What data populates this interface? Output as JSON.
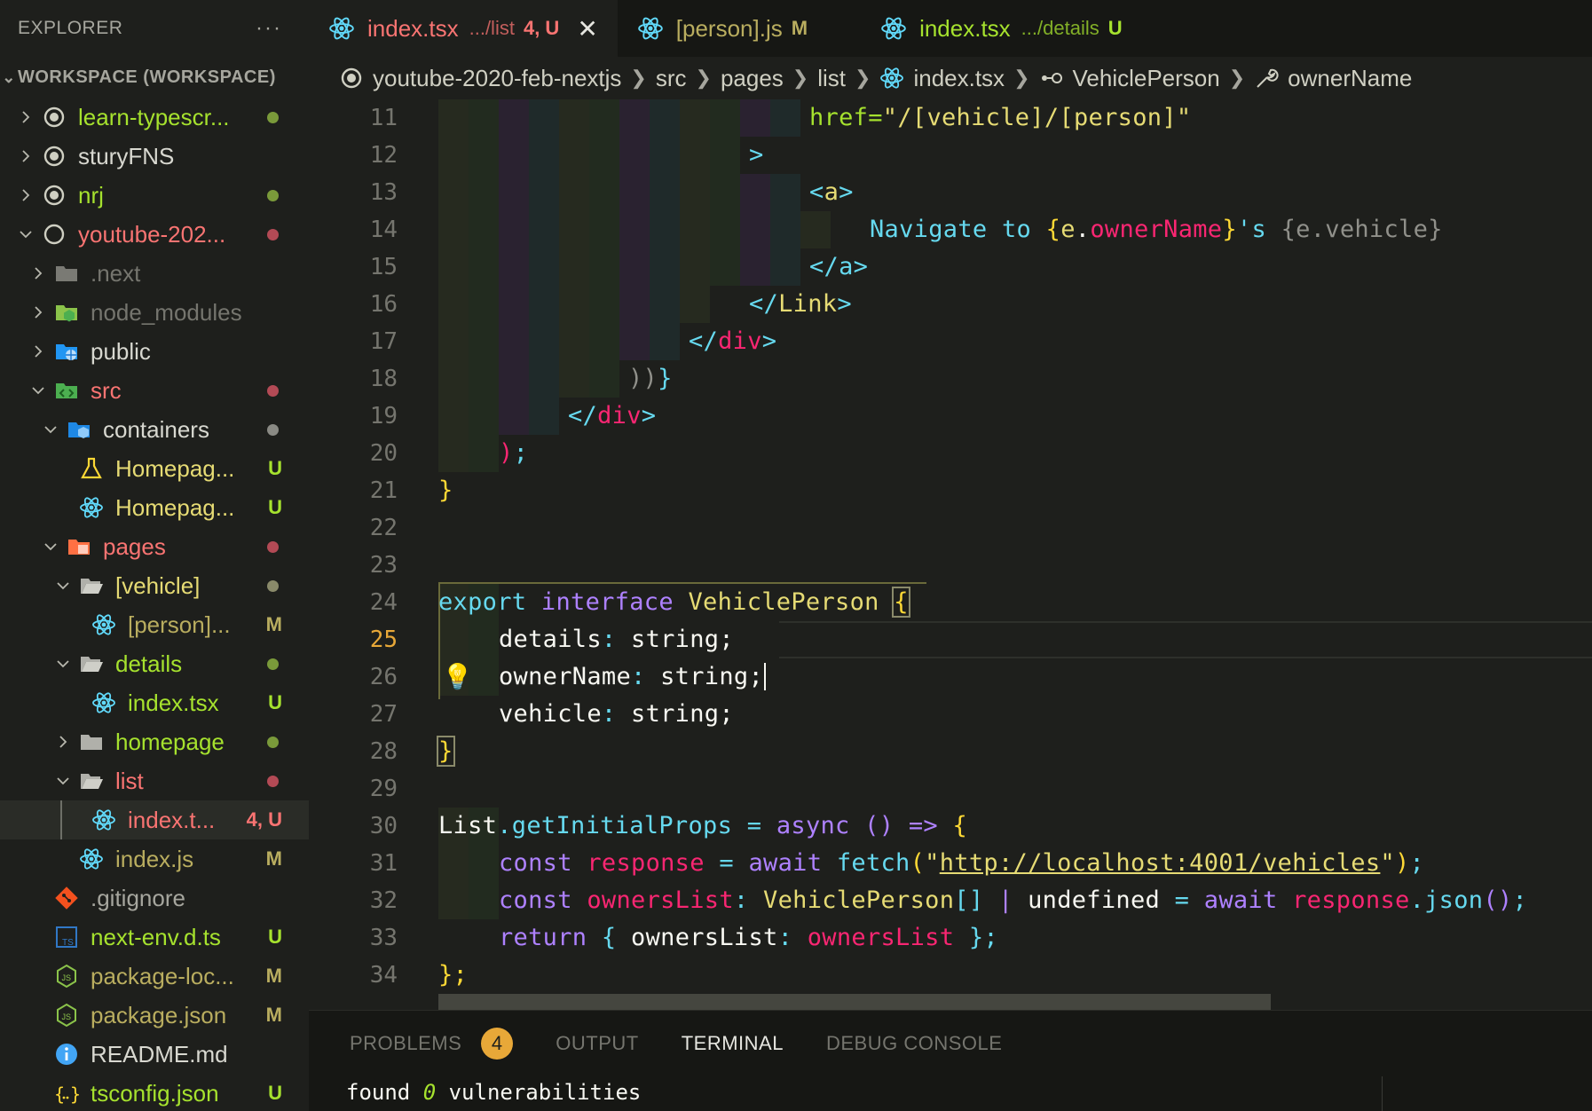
{
  "sidebar": {
    "title": "EXPLORER",
    "more": "···",
    "workspace": "WORKSPACE (WORKSPACE)",
    "items": [
      {
        "label": "learn-typescr...",
        "deco": ""
      },
      {
        "label": "sturyFNS",
        "deco": ""
      },
      {
        "label": "nrj",
        "deco": ""
      },
      {
        "label": "youtube-202...",
        "deco": ""
      },
      {
        "label": ".next",
        "deco": ""
      },
      {
        "label": "node_modules",
        "deco": ""
      },
      {
        "label": "public",
        "deco": ""
      },
      {
        "label": "src",
        "deco": ""
      },
      {
        "label": "containers",
        "deco": ""
      },
      {
        "label": "Homepag...",
        "deco": "U"
      },
      {
        "label": "Homepag...",
        "deco": "U"
      },
      {
        "label": "pages",
        "deco": ""
      },
      {
        "label": "[vehicle]",
        "deco": ""
      },
      {
        "label": "[person]...",
        "deco": "M"
      },
      {
        "label": "details",
        "deco": ""
      },
      {
        "label": "index.tsx",
        "deco": "U"
      },
      {
        "label": "homepage",
        "deco": ""
      },
      {
        "label": "list",
        "deco": ""
      },
      {
        "label": "index.t...",
        "deco": "4, U"
      },
      {
        "label": "index.js",
        "deco": "M"
      },
      {
        "label": ".gitignore",
        "deco": ""
      },
      {
        "label": "next-env.d.ts",
        "deco": "U"
      },
      {
        "label": "package-loc...",
        "deco": "M"
      },
      {
        "label": "package.json",
        "deco": "M"
      },
      {
        "label": "README.md",
        "deco": ""
      },
      {
        "label": "tsconfig.json",
        "deco": "U"
      }
    ]
  },
  "tabs": [
    {
      "label": "index.tsx",
      "desc": ".../list",
      "deco": "4, U",
      "close": "✕"
    },
    {
      "label": "[person].js",
      "desc": "",
      "deco": "M"
    },
    {
      "label": "index.tsx",
      "desc": ".../details",
      "deco": "U"
    }
  ],
  "breadcrumbs": [
    "youtube-2020-feb-nextjs",
    "src",
    "pages",
    "list",
    "index.tsx",
    "VehiclePerson",
    "ownerName"
  ],
  "editor": {
    "line_numbers": [
      "11",
      "12",
      "13",
      "14",
      "15",
      "16",
      "17",
      "18",
      "19",
      "20",
      "21",
      "22",
      "23",
      "24",
      "25",
      "26",
      "27",
      "28",
      "29",
      "30",
      "31",
      "32",
      "33",
      "34"
    ],
    "code": {
      "l11_attr": "href=",
      "l11_val": "\"/[vehicle]/[person]\"",
      "l12": ">",
      "l13_open": "<",
      "l13_tag": "a",
      "l13_close": ">",
      "l14_text": "Navigate to ",
      "l14_ob": "{",
      "l14_e": "e",
      "l14_dot": ".",
      "l14_prop": "ownerName",
      "l14_cb": "}",
      "l14_s": "'s ",
      "l14_expr2": "{e.vehicle}",
      "l15": "</a>",
      "l16_a": "</",
      "l16_tag": "Link",
      "l16_b": ">",
      "l17_a": "</",
      "l17_tag": "div",
      "l17_b": ">",
      "l18_a": "))",
      "l18_b": "}",
      "l19_a": "</",
      "l19_tag": "div",
      "l19_b": ">",
      "l20_a": ")",
      "l20_b": ";",
      "l21": "}",
      "l23_export": "export",
      "l23_interface": "interface",
      "l23_name": "VehiclePerson",
      "l23_brace": "{",
      "l24_prop": "details",
      "l24_type": "string;",
      "l25_prop": "ownerName",
      "l25_type": "string;",
      "l26_prop": "vehicle",
      "l26_type": "string;",
      "l27": "}",
      "l29_obj": "List",
      "l29_fn": "getInitialProps",
      "l29_eq": "=",
      "l29_async": "async",
      "l29_params": "()",
      "l29_arrow": "=>",
      "l29_brace": "{",
      "l30_const": "const",
      "l30_var": "response",
      "l30_eq": "=",
      "l30_await": "await",
      "l30_fn": "fetch",
      "l30_url": "http://localhost:4001/vehicles",
      "l31_const": "const",
      "l31_var": "ownersList",
      "l31_type": "VehiclePerson",
      "l31_arr": "[]",
      "l31_pipe": "|",
      "l31_undef": "undefined",
      "l31_eq": "=",
      "l31_await": "await",
      "l31_obj": "response",
      "l31_fn": "json",
      "l32_return": "return",
      "l32_key": "ownersList",
      "l32_val": "ownersList",
      "l33": "};"
    },
    "lightbulb": "💡"
  },
  "panel": {
    "tabs": [
      "PROBLEMS",
      "OUTPUT",
      "TERMINAL",
      "DEBUG CONSOLE"
    ],
    "problems_count": "4",
    "terminal": {
      "pre": "found ",
      "count": "0",
      "post": " vulnerabilities"
    }
  },
  "colors": {
    "untracked": "#a6e22e",
    "modified": "#e6db74",
    "error": "#f92672",
    "accent": "#e8a838",
    "react": "#61dafb"
  }
}
